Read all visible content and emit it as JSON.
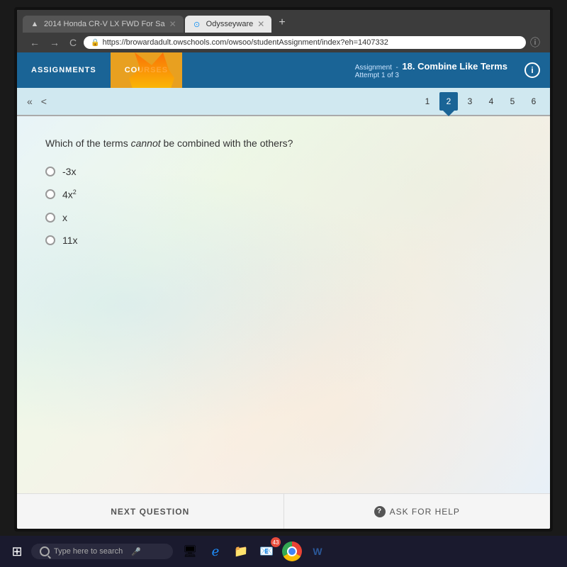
{
  "browser": {
    "tabs": [
      {
        "id": "tab-car",
        "label": "2014 Honda CR-V LX FWD For Sa",
        "icon": "car-icon",
        "active": false
      },
      {
        "id": "tab-odysseyware",
        "label": "Odysseyware",
        "icon": "odysseyware-icon",
        "active": true
      }
    ],
    "address": "https://browardadult.owschools.com/owsoo/studentAssignment/index?eh=1407332",
    "nav": {
      "back": "←",
      "forward": "→",
      "refresh": "C"
    }
  },
  "app": {
    "nav_items": [
      {
        "id": "assignments",
        "label": "ASSIGNMENTS"
      },
      {
        "id": "courses",
        "label": "COURSES"
      }
    ],
    "assignment_label": "Assignment",
    "assignment_name": "18. Combine Like Terms",
    "attempt_label": "Attempt 1 of 3"
  },
  "question_nav": {
    "arrows": {
      "double_left": "«",
      "left": "<"
    },
    "numbers": [
      1,
      2,
      3,
      4,
      5,
      6
    ],
    "current": 2
  },
  "question": {
    "text": "Which of the terms cannot be combined with the others?",
    "cannot_italic": "cannot",
    "options": [
      {
        "id": "a",
        "label": "-3x",
        "superscript": ""
      },
      {
        "id": "b",
        "label": "4x",
        "superscript": "2"
      },
      {
        "id": "c",
        "label": "x",
        "superscript": ""
      },
      {
        "id": "d",
        "label": "11x",
        "superscript": ""
      }
    ]
  },
  "bottom_bar": {
    "next_question": "NEXT QUESTION",
    "ask_for_help": "ASK FOR HELP"
  },
  "taskbar": {
    "search_placeholder": "Type here to search",
    "apps": [
      "⊞",
      "🖥",
      "📁",
      "📧"
    ],
    "notification_count": "43"
  }
}
